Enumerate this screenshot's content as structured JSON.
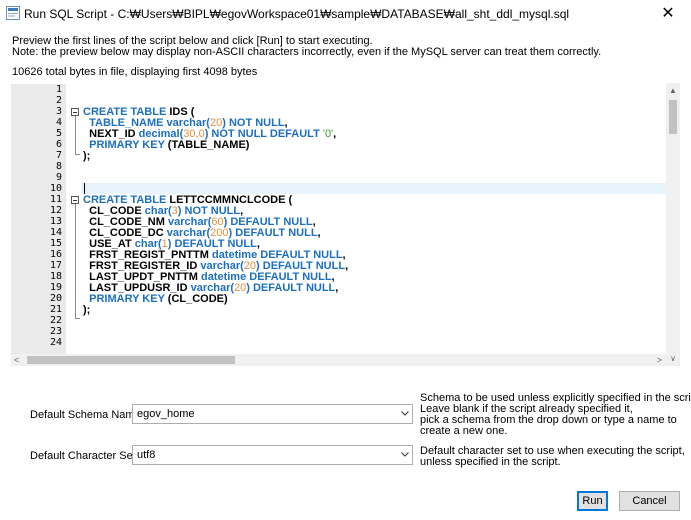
{
  "window": {
    "title": "Run SQL Script - C:₩Users₩BIPL₩egovWorkspace01₩sample₩DATABASE₩all_sht_ddl_mysql.sql",
    "close_glyph": "✕"
  },
  "intro": {
    "line1": "Preview the first lines of the script below and click [Run] to start executing.",
    "line2": "Note: the preview below may display non-ASCII characters incorrectly, even if the MySQL server can treat them correctly.",
    "bytes_info": "10626 total bytes in file, displaying first 4098 bytes"
  },
  "editor": {
    "line_numbers": [
      "1",
      "2",
      "3",
      "4",
      "5",
      "6",
      "7",
      "8",
      "9",
      "10",
      "11",
      "12",
      "13",
      "14",
      "15",
      "16",
      "17",
      "18",
      "19",
      "20",
      "21",
      "22",
      "23",
      "24"
    ],
    "code": {
      "l3": {
        "kw1": "CREATE TABLE",
        "ident": " IDS ("
      },
      "l4": {
        "indent": "  ",
        "ident": "TABLE_NAME ",
        "kw": "varchar(",
        "num": "20",
        "kw2": ") NOT NULL",
        "tail": ","
      },
      "l5": {
        "indent": "  ",
        "ident": "NEXT_ID ",
        "kw": "decimal(",
        "num": "30,0",
        "kw2": ") NOT NULL DEFAULT ",
        "str": "'0'",
        "tail": ","
      },
      "l6": {
        "indent": "  ",
        "kw": "PRIMARY KEY",
        "ident": " (TABLE_NAME)"
      },
      "l7": {
        "text": ");"
      },
      "l11": {
        "kw1": "CREATE TABLE",
        "ident": " LETTCCMMNCLCODE ("
      },
      "l12": {
        "indent": "  ",
        "ident": "CL_CODE ",
        "kw": "char(",
        "num": "3",
        "kw2": ") NOT NULL",
        "tail": ","
      },
      "l13": {
        "indent": "  ",
        "ident": "CL_CODE_NM ",
        "kw": "varchar(",
        "num": "60",
        "kw2": ") DEFAULT NULL",
        "tail": ","
      },
      "l14": {
        "indent": "  ",
        "ident": "CL_CODE_DC ",
        "kw": "varchar(",
        "num": "200",
        "kw2": ") DEFAULT NULL",
        "tail": ","
      },
      "l15": {
        "indent": "  ",
        "ident": "USE_AT ",
        "kw": "char(",
        "num": "1",
        "kw2": ") DEFAULT NULL",
        "tail": ","
      },
      "l16": {
        "indent": "  ",
        "ident": "FRST_REGIST_PNTTM ",
        "kw": "datetime DEFAULT NULL",
        "tail": ","
      },
      "l17": {
        "indent": "  ",
        "ident": "FRST_REGISTER_ID ",
        "kw": "varchar(",
        "num": "20",
        "kw2": ") DEFAULT NULL",
        "tail": ","
      },
      "l18": {
        "indent": "  ",
        "ident": "LAST_UPDT_PNTTM ",
        "kw": "datetime DEFAULT NULL",
        "tail": ","
      },
      "l19": {
        "indent": "  ",
        "ident": "LAST_UPDUSR_ID ",
        "kw": "varchar(",
        "num": "20",
        "kw2": ") DEFAULT NULL",
        "tail": ","
      },
      "l20": {
        "indent": "  ",
        "kw": "PRIMARY KEY",
        "ident": " (CL_CODE)"
      },
      "l21": {
        "text": ");"
      }
    }
  },
  "schema": {
    "label": "Default Schema Name:",
    "value": "egov_home",
    "hint_lines": [
      "Schema to be used unless explicitly specified in the script.",
      "Leave blank if the script already specified it,",
      "pick a schema from the drop down or type a name to",
      "create a new one."
    ]
  },
  "charset": {
    "label": "Default Character Set:",
    "value": "utf8",
    "hint_lines": [
      "Default character set to use when executing the script,",
      "unless specified in the script."
    ]
  },
  "buttons": {
    "run": "Run",
    "cancel": "Cancel"
  },
  "colors": {
    "keyword": "#1c6fc0",
    "number": "#e58f3c",
    "string": "#3c9a2a",
    "default_button_border": "#0078d7"
  }
}
